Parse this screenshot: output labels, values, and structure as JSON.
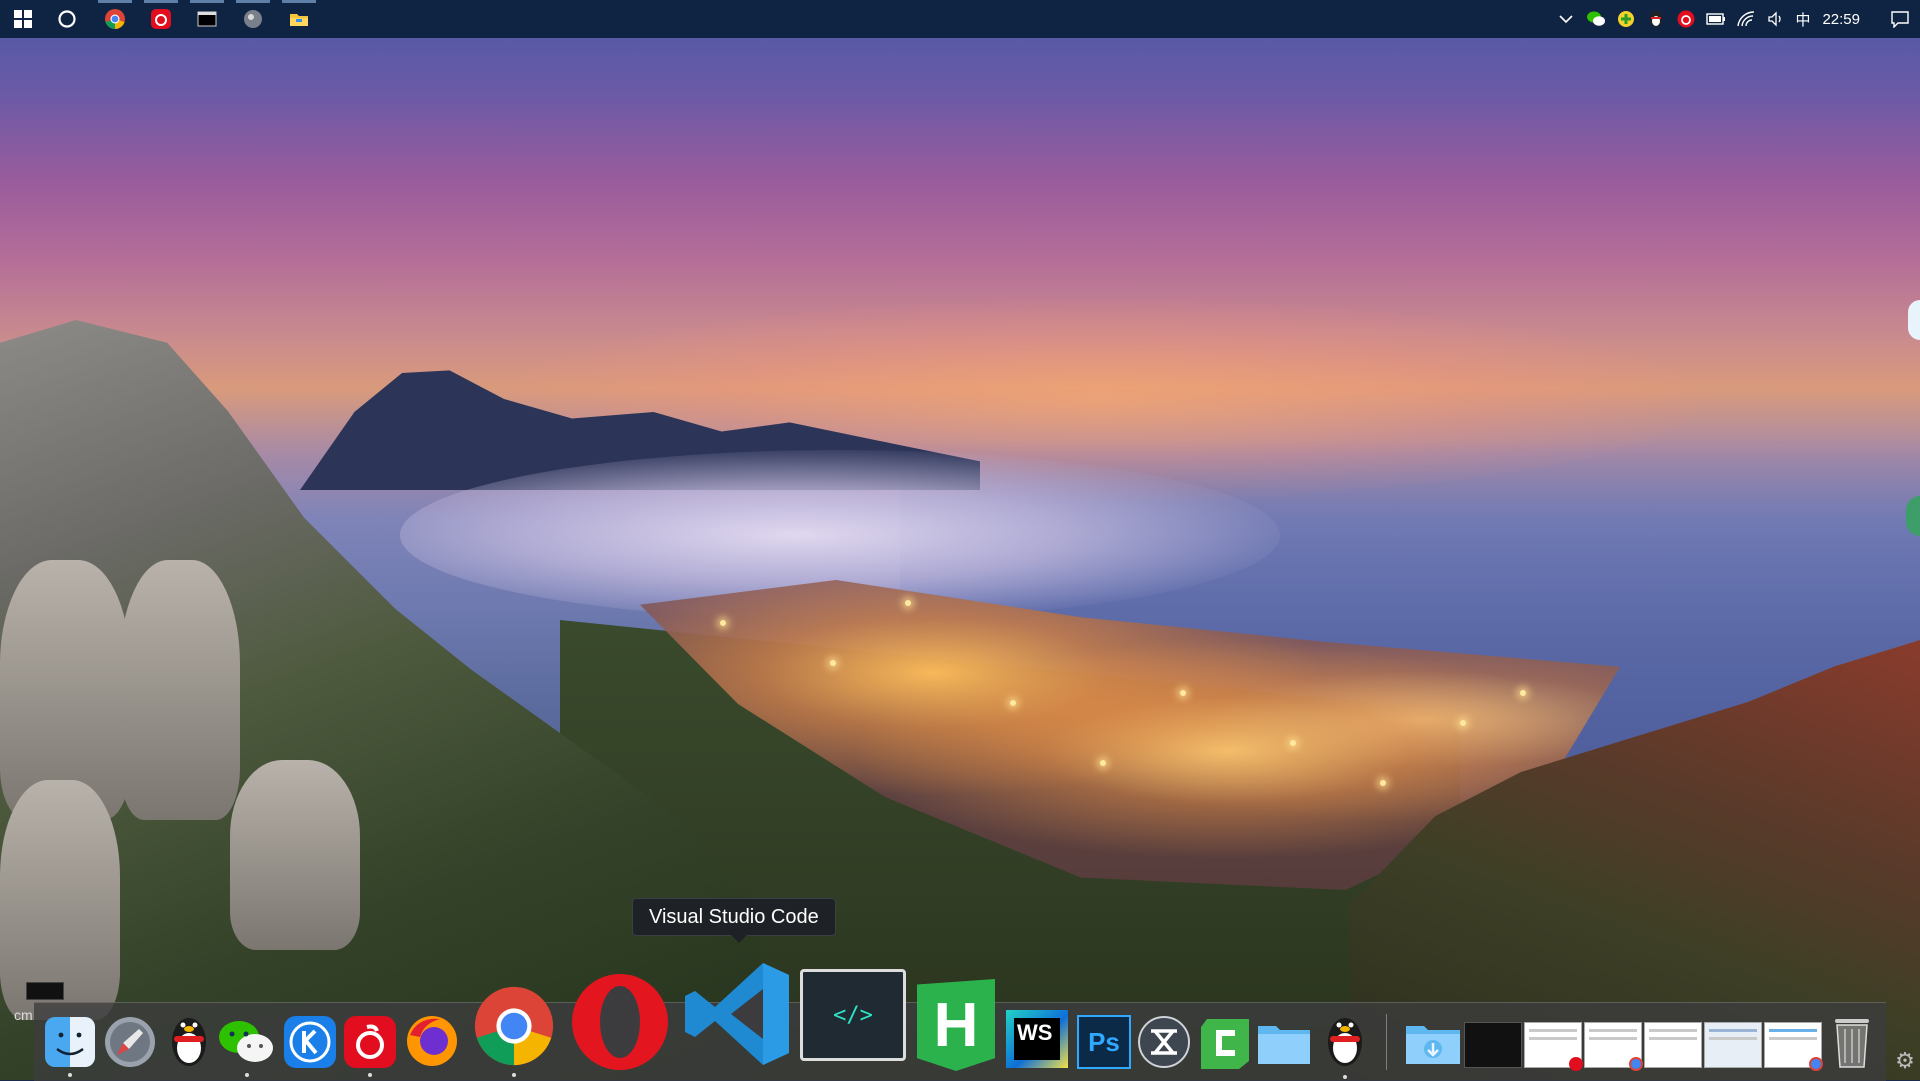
{
  "taskbar": {
    "start_icon": "windows-icon",
    "search_icon": "cortana-circle-icon",
    "pinned": [
      {
        "name": "chrome-icon"
      },
      {
        "name": "netease-music-icon"
      },
      {
        "name": "terminal-icon"
      },
      {
        "name": "photo-app-icon"
      },
      {
        "name": "file-explorer-icon"
      }
    ],
    "tray": {
      "icons": [
        "show-hidden-icons-chevron",
        "wechat-tray-icon",
        "green-plus-tray-icon",
        "qq-tray-icon",
        "netease-tray-icon",
        "battery-icon",
        "wifi-icon",
        "volume-icon"
      ],
      "ime": "中",
      "time": "22:59",
      "notification_icon": "action-center-icon"
    }
  },
  "tooltip": {
    "text": "Visual Studio Code"
  },
  "minimized": {
    "label": "cm"
  },
  "dock": {
    "apps": [
      {
        "name": "finder-icon"
      },
      {
        "name": "launchpad-rocket-icon"
      },
      {
        "name": "qq-penguin-icon"
      },
      {
        "name": "wechat-icon"
      },
      {
        "name": "kugou-k-icon"
      },
      {
        "name": "netease-music-icon"
      },
      {
        "name": "firefox-icon"
      },
      {
        "name": "chrome-icon"
      },
      {
        "name": "opera-icon"
      },
      {
        "name": "visual-studio-code-icon"
      },
      {
        "name": "code-editor-terminal-icon",
        "glyph": "</>"
      },
      {
        "name": "hbuilder-icon",
        "glyph": "H"
      },
      {
        "name": "webstorm-icon",
        "glyph": "WS"
      },
      {
        "name": "photoshop-icon",
        "glyph": "Ps"
      },
      {
        "name": "xmind-icon"
      },
      {
        "name": "camtasia-icon"
      },
      {
        "name": "folder-icon"
      },
      {
        "name": "qq-penguin-icon-2"
      }
    ],
    "right": [
      {
        "name": "downloads-folder-icon"
      },
      {
        "name": "terminal-window-thumbnail"
      },
      {
        "name": "browser-window-thumbnail-1"
      },
      {
        "name": "browser-window-thumbnail-2"
      },
      {
        "name": "browser-window-thumbnail-3"
      },
      {
        "name": "browser-window-thumbnail-4"
      },
      {
        "name": "browser-window-thumbnail-5"
      },
      {
        "name": "trash-icon"
      }
    ],
    "settings_icon": "gear-icon"
  },
  "colors": {
    "taskbar": "#0f2442",
    "dock": "#3c3c3e",
    "vscode": "#1f8ad2",
    "hbuilder": "#2bb24c",
    "photoshop": "#0b2a47",
    "webstorm": "#0e6fd8",
    "opera": "#e3151f"
  }
}
